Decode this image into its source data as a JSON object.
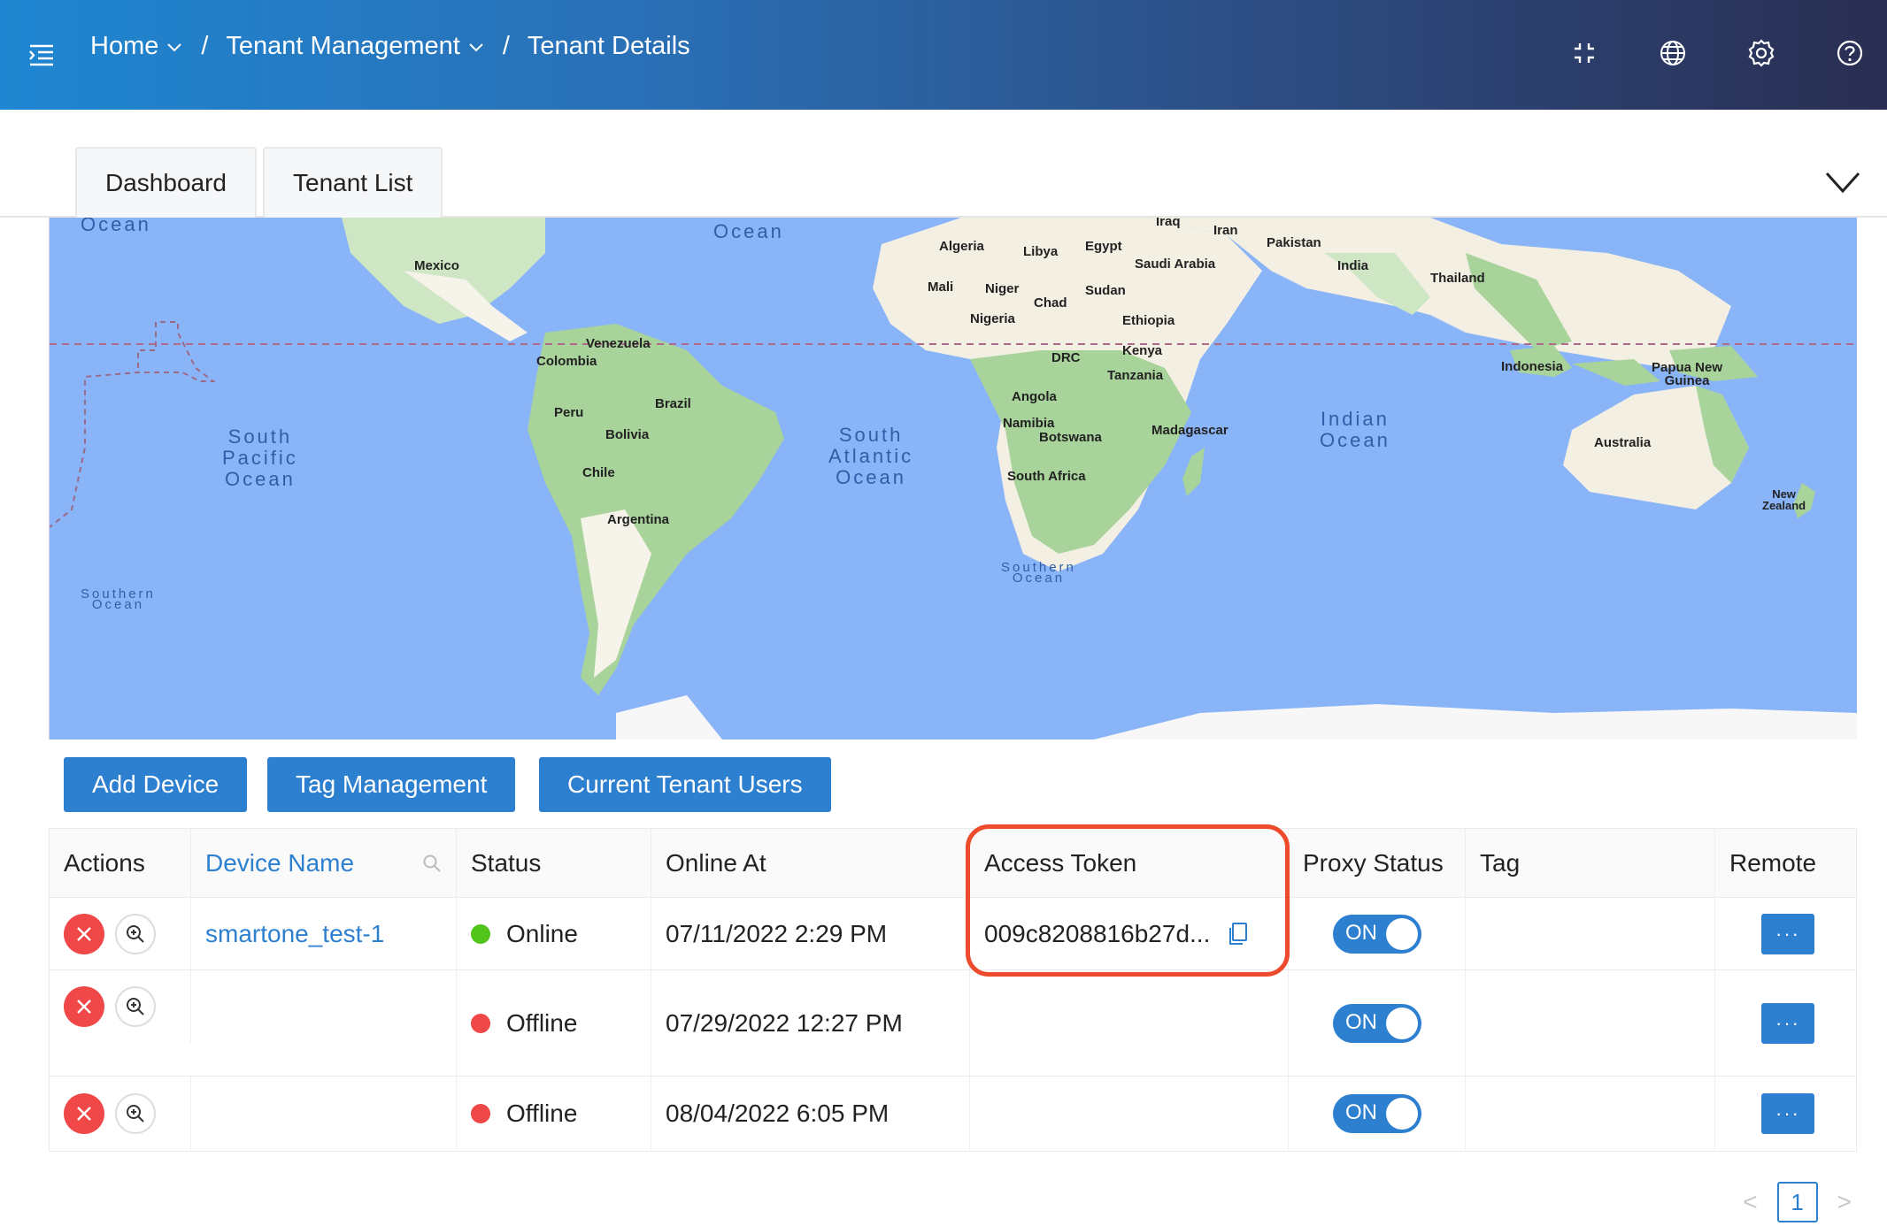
{
  "header": {
    "breadcrumb": [
      {
        "label": "Home",
        "has_dropdown": true
      },
      {
        "label": "Tenant Management",
        "has_dropdown": true
      },
      {
        "label": "Tenant Details",
        "has_dropdown": false
      }
    ],
    "separator": "/",
    "icons": [
      "menu-toggle-icon",
      "fullscreen-icon",
      "globe-icon",
      "gear-icon",
      "help-icon"
    ]
  },
  "tabs": [
    {
      "label": "Dashboard"
    },
    {
      "label": "Tenant List"
    }
  ],
  "map": {
    "countries": [
      "Mexico",
      "Venezuela",
      "Colombia",
      "Peru",
      "Brazil",
      "Bolivia",
      "Chile",
      "Argentina",
      "Algeria",
      "Libya",
      "Egypt",
      "Mali",
      "Niger",
      "Sudan",
      "Chad",
      "Nigeria",
      "Ethiopia",
      "Kenya",
      "DRC",
      "Tanzania",
      "Angola",
      "Namibia",
      "Botswana",
      "South Africa",
      "Madagascar",
      "Iraq",
      "Iran",
      "Pakistan",
      "Saudi Arabia",
      "India",
      "Thailand",
      "Indonesia",
      "Papua New\nGuinea",
      "Australia",
      "New\nZealand"
    ],
    "oceans": [
      "Ocean",
      "Ocean",
      "South\nPacific\nOcean",
      "South\nAtlantic\nOcean",
      "Indian\nOcean",
      "Southern\nOcean",
      "Southern\nOcean"
    ]
  },
  "toolbar": {
    "add_device": "Add Device",
    "tag_management": "Tag Management",
    "current_tenant_users": "Current Tenant Users"
  },
  "table": {
    "columns": [
      "Actions",
      "Device Name",
      "Status",
      "Online At",
      "Access Token",
      "Proxy Status",
      "Tag",
      "Remote"
    ],
    "rows": [
      {
        "device_name": "smartone_test-1",
        "status": "Online",
        "status_color": "#52c41a",
        "online_at": "07/11/2022 2:29 PM",
        "access_token": "009c8208816b27d...",
        "proxy": "ON",
        "tag": "",
        "remote": "···"
      },
      {
        "device_name": "",
        "status": "Offline",
        "status_color": "#f04848",
        "online_at": "07/29/2022 12:27 PM",
        "access_token": "",
        "proxy": "ON",
        "tag": "",
        "remote": "···"
      },
      {
        "device_name": "",
        "status": "Offline",
        "status_color": "#f04848",
        "online_at": "08/04/2022 6:05 PM",
        "access_token": "",
        "proxy": "ON",
        "tag": "",
        "remote": "···"
      }
    ]
  },
  "pagination": {
    "current": "1",
    "prev": "<",
    "next": ">"
  },
  "colors": {
    "primary": "#2d7fd0",
    "highlight": "#ee4a2c",
    "online": "#52c41a",
    "offline": "#f04848"
  }
}
